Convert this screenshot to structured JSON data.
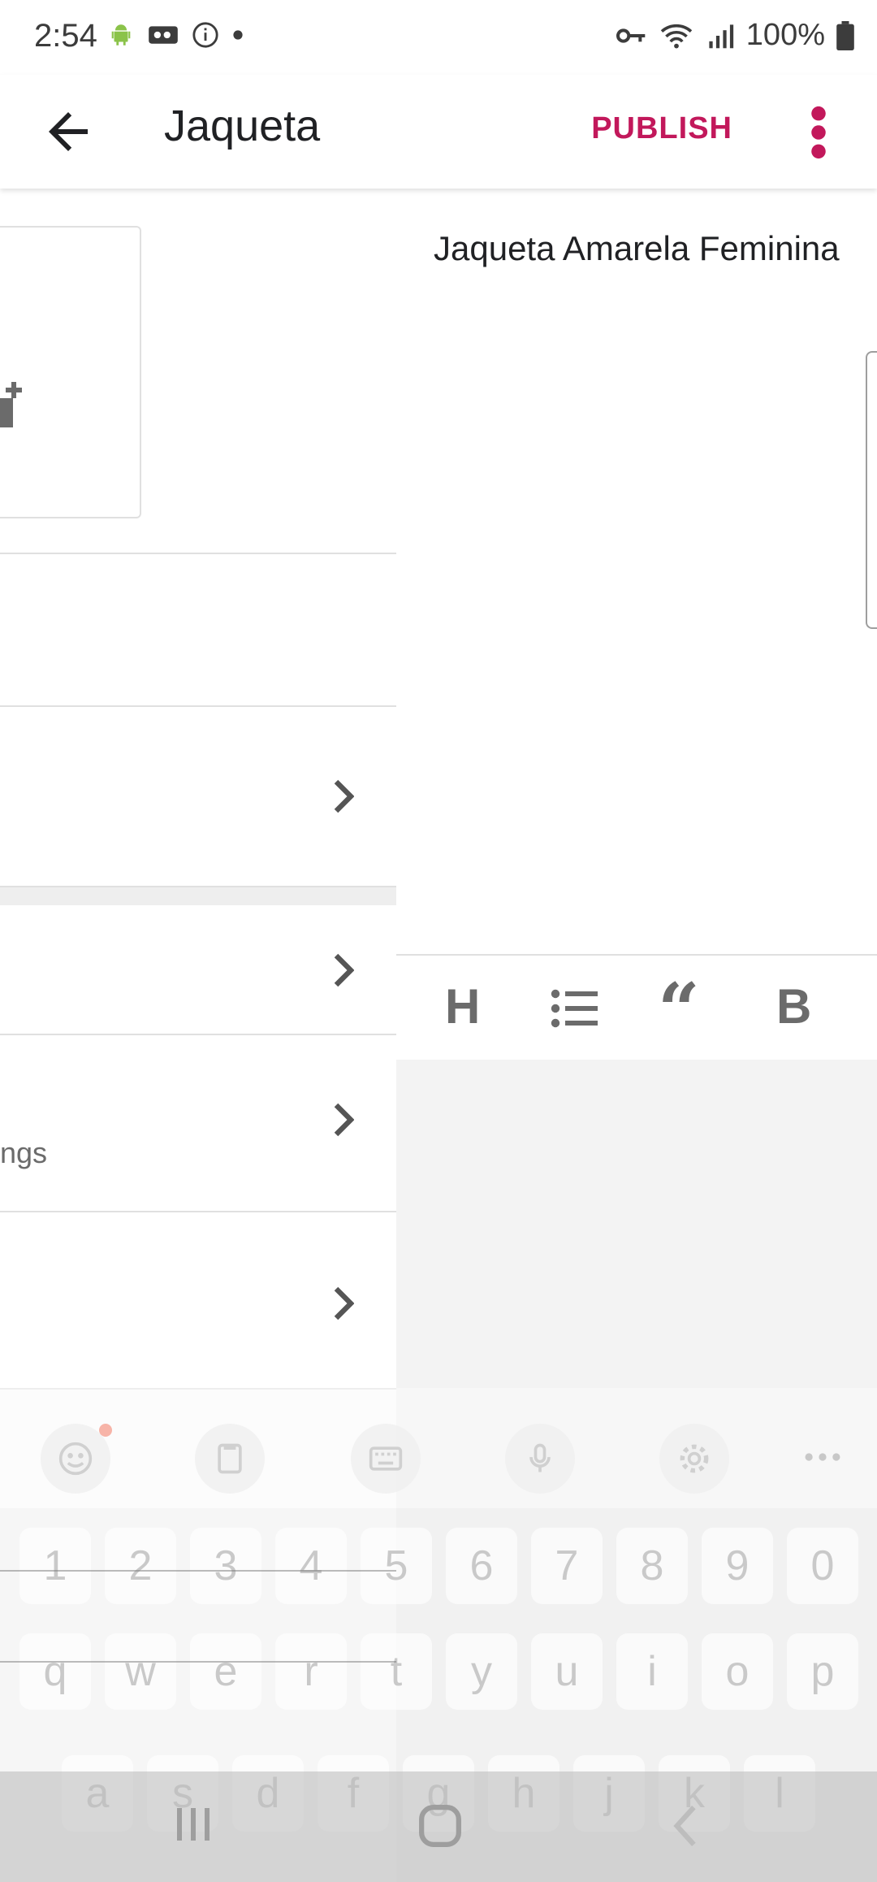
{
  "status_bar": {
    "time": "2:54",
    "battery": "100%"
  },
  "app_bar": {
    "title": "Jaqueta",
    "publish_label": "PUBLISH"
  },
  "left_panel": {
    "settings_partial": "ngs"
  },
  "editor": {
    "content": "Jaqueta Amarela Feminina",
    "toolbar": {
      "heading": "H",
      "quote": "“",
      "bold": "B"
    }
  },
  "keyboard": {
    "number_row": [
      "1",
      "2",
      "3",
      "4",
      "5",
      "6",
      "7",
      "8",
      "9",
      "0"
    ],
    "row1": [
      "q",
      "w",
      "e",
      "r",
      "t",
      "y",
      "u",
      "i",
      "o",
      "p"
    ],
    "row2": [
      "a",
      "s",
      "d",
      "f",
      "g",
      "h",
      "j",
      "k",
      "l"
    ]
  },
  "colors": {
    "accent": "#c2185b",
    "icon_gray": "#6b6b6b"
  }
}
